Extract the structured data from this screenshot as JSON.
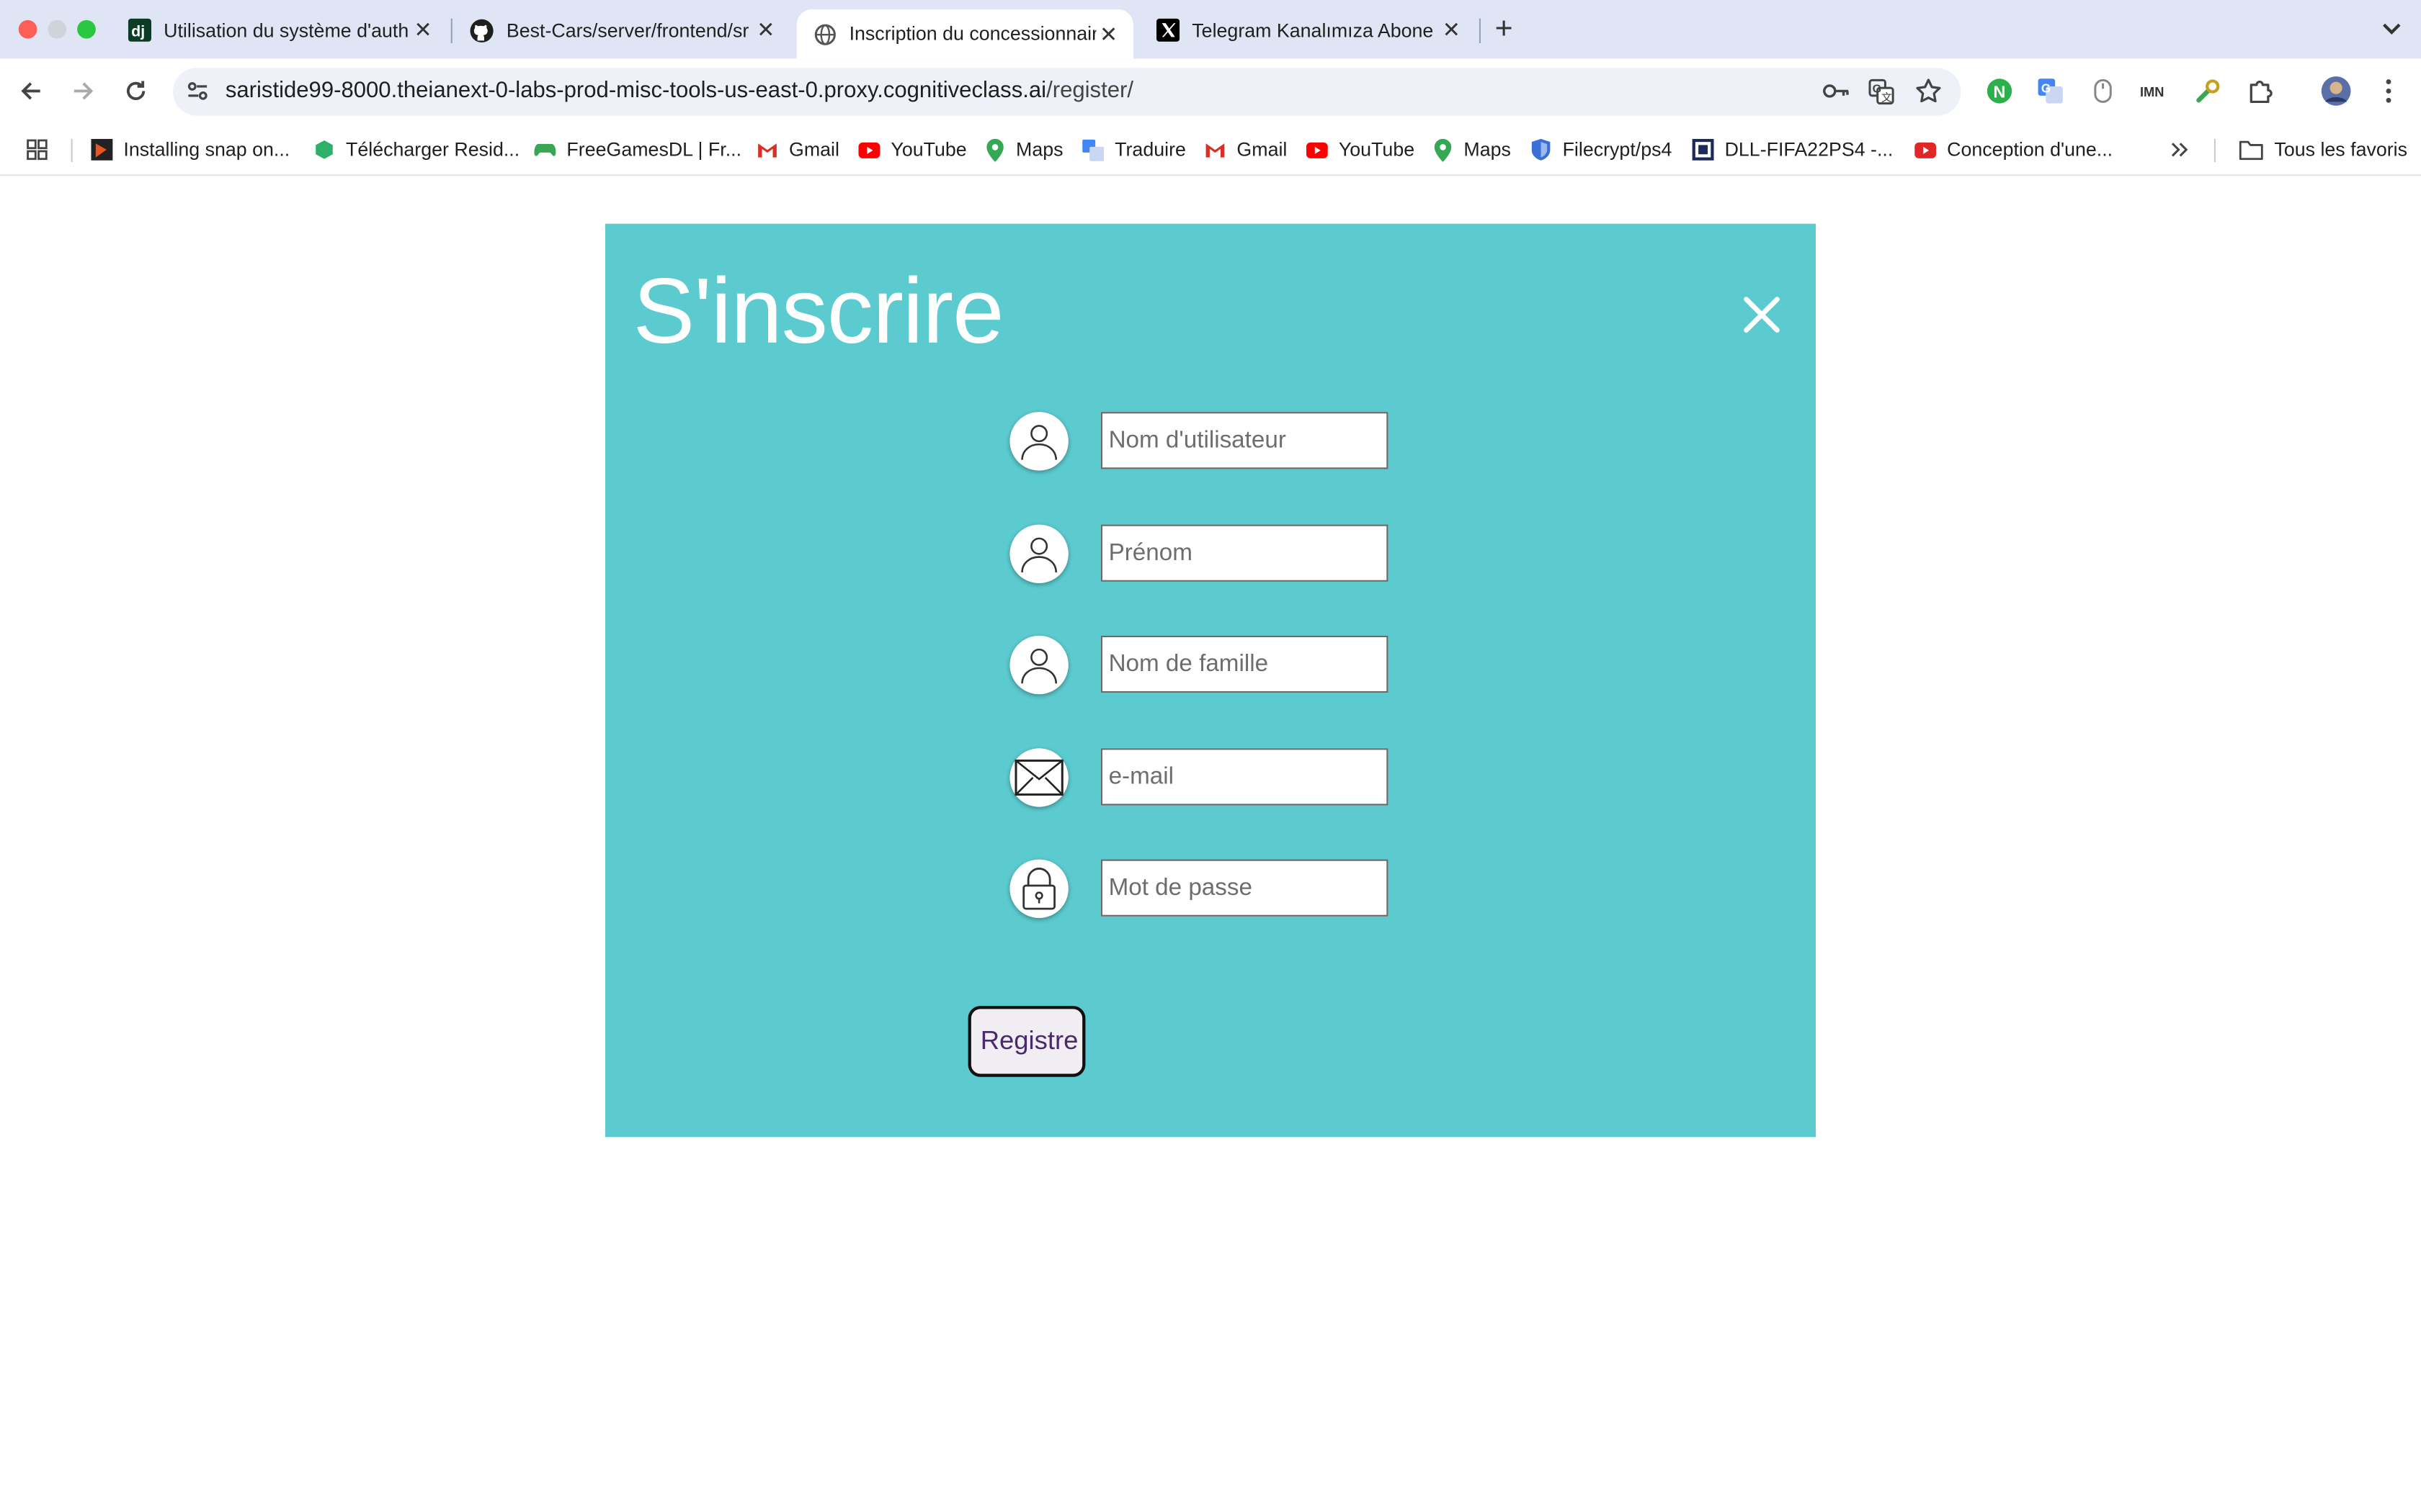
{
  "browser": {
    "tabs": [
      {
        "title": "Utilisation du système d'auth",
        "icon": "django-icon"
      },
      {
        "title": "Best-Cars/server/frontend/sr",
        "icon": "github-icon"
      },
      {
        "title": "Inscription du concessionnair",
        "icon": "globe-icon"
      },
      {
        "title": "Telegram Kanalımıza Abone O",
        "icon": "x-logo-icon"
      }
    ],
    "url_host": "saristide99-8000.theianext-0-labs-prod-misc-tools-us-east-0.proxy.cognitiveclass.ai",
    "url_path": "/register/",
    "bookmarks": [
      {
        "label": "Installing snap on...",
        "icon": "snapcraft-icon",
        "color": "#222222"
      },
      {
        "label": "Télécharger Resid...",
        "icon": "game-icon",
        "color": "#2fb06a"
      },
      {
        "label": "FreeGamesDL | Fr...",
        "icon": "gamepad-icon",
        "color": "#3aa655"
      },
      {
        "label": "Gmail",
        "icon": "gmail-icon",
        "color": "#d93025"
      },
      {
        "label": "YouTube",
        "icon": "youtube-icon",
        "color": "#ff0000"
      },
      {
        "label": "Maps",
        "icon": "maps-icon",
        "color": "#34a853"
      },
      {
        "label": "Traduire",
        "icon": "translate-icon",
        "color": "#4285f4"
      },
      {
        "label": "Gmail",
        "icon": "gmail-icon",
        "color": "#d93025"
      },
      {
        "label": "YouTube",
        "icon": "youtube-icon",
        "color": "#ff0000"
      },
      {
        "label": "Maps",
        "icon": "maps-icon",
        "color": "#34a853"
      },
      {
        "label": "Filecrypt/ps4",
        "icon": "shield-icon",
        "color": "#3b6fd8"
      },
      {
        "label": "DLL-FIFA22PS4 -...",
        "icon": "dll-icon",
        "color": "#1a2a5a"
      },
      {
        "label": "Conception d'une...",
        "icon": "youtube-icon",
        "color": "#e02828"
      }
    ],
    "all_bookmarks": "Tous les favoris"
  },
  "page": {
    "title": "S'inscrire",
    "panel_color": "#5ccbcf",
    "fields": [
      {
        "placeholder": "Nom d'utilisateur",
        "icon": "user-icon"
      },
      {
        "placeholder": "Prénom",
        "icon": "user-icon"
      },
      {
        "placeholder": "Nom de famille",
        "icon": "user-icon"
      },
      {
        "placeholder": "e-mail",
        "icon": "envelope-icon"
      },
      {
        "placeholder": "Mot de passe",
        "icon": "lock-icon"
      }
    ],
    "submit_label": "Registre"
  }
}
